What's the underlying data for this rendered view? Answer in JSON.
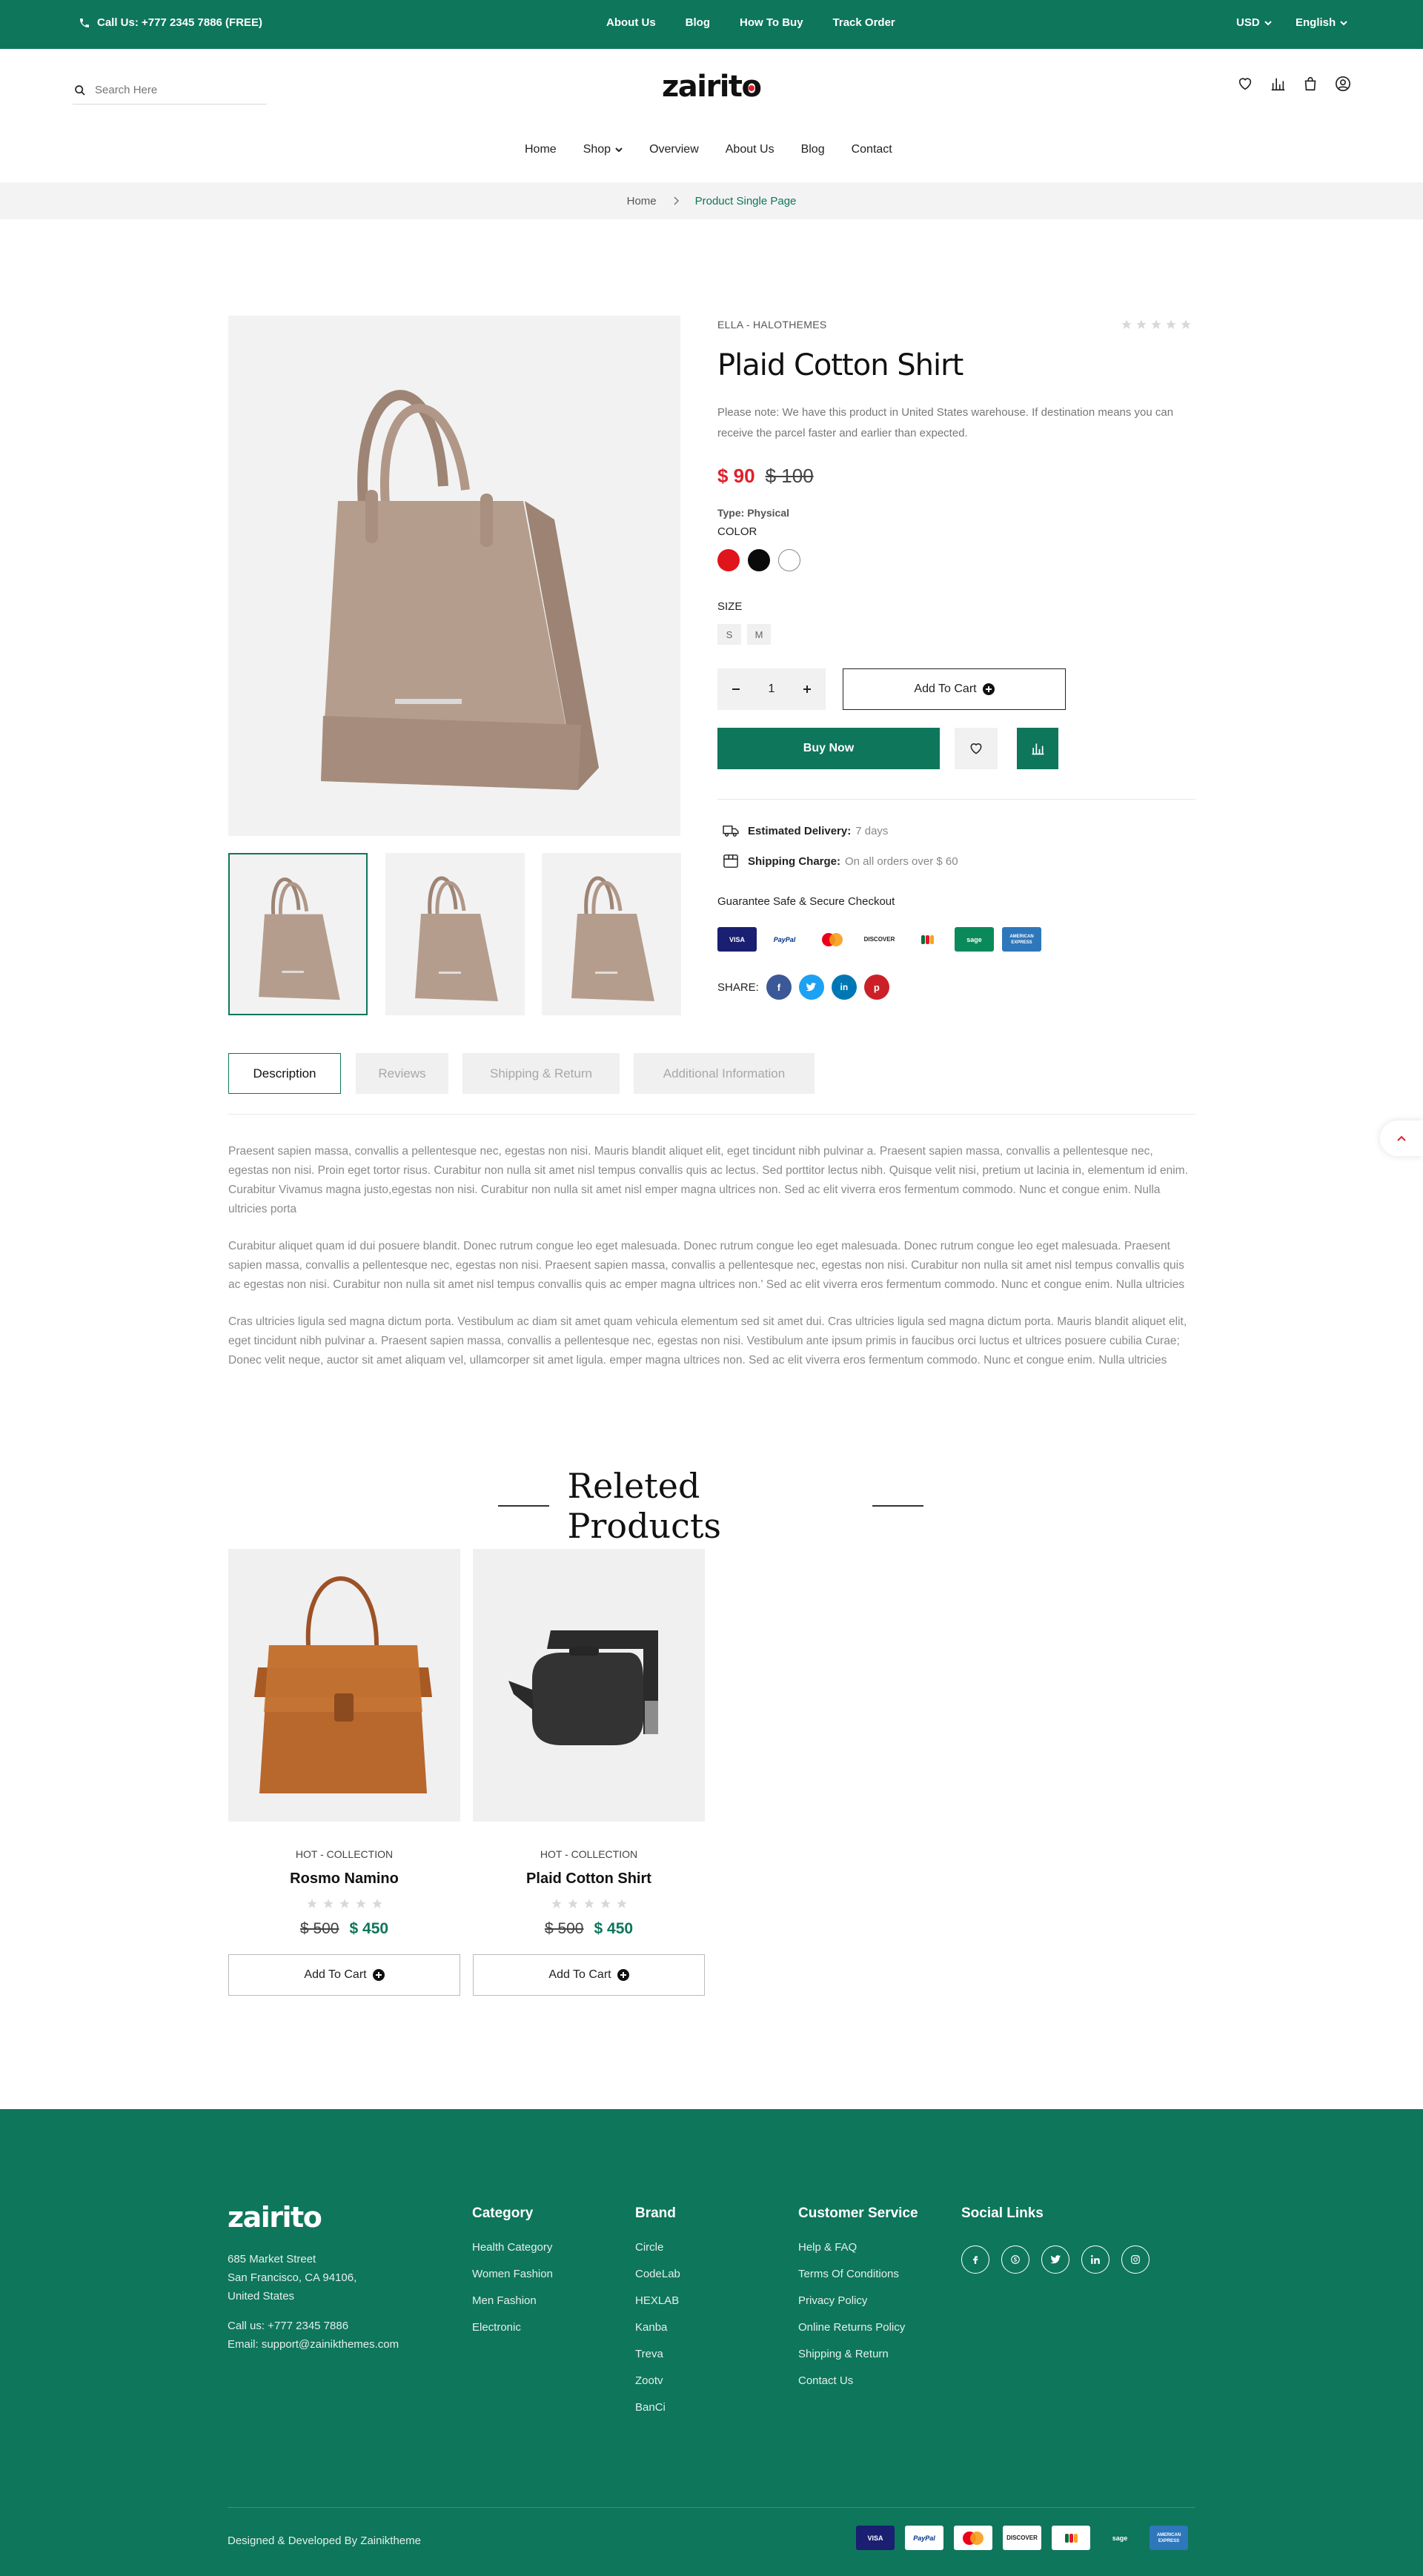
{
  "topbar": {
    "call": "Call Us: +777 2345 7886 (FREE)",
    "links": [
      "About Us",
      "Blog",
      "How To Buy",
      "Track Order"
    ],
    "currency": "USD",
    "language": "English"
  },
  "header": {
    "search_placeholder": "Search Here",
    "logo_text": "zairito",
    "nav": [
      "Home",
      "Shop",
      "Overview",
      "About Us",
      "Blog",
      "Contact"
    ]
  },
  "breadcrumb": {
    "home": "Home",
    "current": "Product Single Page"
  },
  "product": {
    "vendor": "ELLA - HALOTHEMES",
    "rating": 0,
    "name": "Plaid Cotton Shirt",
    "note": "Please note: We have this product in United States warehouse. If destination means you can receive the parcel faster and earlier than expected.",
    "price": "$ 90",
    "old_price": "$ 100",
    "type_label": "Type: Physical",
    "color_label": "COLOR",
    "colors": [
      "#e0141b",
      "#0a0a0a",
      "#ffffff"
    ],
    "size_label": "SIZE",
    "sizes": [
      "S",
      "M"
    ],
    "quantity": "1",
    "add_to_cart": "Add To Cart",
    "buy_now": "Buy Now",
    "delivery_label": "Estimated Delivery:",
    "delivery_value": "7 days",
    "shipping_label": "Shipping Charge:",
    "shipping_value": "On all orders over $ 60",
    "guarantee": "Guarantee Safe & Secure Checkout",
    "payments": [
      "VISA",
      "PayPal",
      "mastercard",
      "DISCOVER",
      "jcb",
      "sage",
      "AMERICAN EXPRESS"
    ],
    "share_label": "SHARE:"
  },
  "tabs": [
    "Description",
    "Reviews",
    "Shipping & Return",
    "Additional Information"
  ],
  "description": [
    "Praesent sapien massa, convallis a pellentesque nec, egestas non nisi. Mauris blandit aliquet elit, eget tincidunt nibh pulvinar a. Praesent sapien massa, convallis a pellentesque nec, egestas non nisi. Proin eget tortor risus. Curabitur non nulla sit amet nisl tempus convallis quis ac lectus. Sed porttitor lectus nibh. Quisque velit nisi, pretium ut lacinia in, elementum id enim. Curabitur Vivamus magna justo,egestas non nisi. Curabitur non nulla sit amet nisl emper magna ultrices non. Sed ac elit viverra eros fermentum commodo. Nunc et congue enim. Nulla ultricies porta",
    "Curabitur aliquet quam id dui posuere blandit. Donec rutrum congue leo eget malesuada. Donec rutrum congue leo eget malesuada. Donec rutrum congue leo eget malesuada. Praesent sapien massa, convallis a pellentesque nec, egestas non nisi. Praesent sapien massa, convallis a pellentesque nec, egestas non nisi. Curabitur non nulla sit amet nisl tempus convallis quis ac egestas non nisi. Curabitur non nulla sit amet nisl tempus convallis quis ac emper magna ultrices non.' Sed ac elit viverra eros fermentum commodo. Nunc et congue enim. Nulla ultricies",
    "Cras ultricies ligula sed magna dictum porta. Vestibulum ac diam sit amet quam vehicula elementum sed sit amet dui. Cras ultricies ligula sed magna dictum porta. Mauris blandit aliquet elit, eget tincidunt nibh pulvinar a. Praesent sapien massa, convallis a pellentesque nec, egestas non nisi. Vestibulum ante ipsum primis in faucibus orci luctus et ultrices posuere cubilia Curae; Donec velit neque, auctor sit amet aliquam vel, ullamcorper sit amet ligula. emper magna ultrices non. Sed ac elit viverra eros fermentum commodo. Nunc et congue enim. Nulla ultricies"
  ],
  "related": {
    "title": "Releted Products",
    "items": [
      {
        "collection": "HOT - COLLECTION",
        "name": "Rosmo Namino",
        "old_price": "$ 500",
        "price": "$ 450",
        "button": "Add To Cart"
      },
      {
        "collection": "HOT - COLLECTION",
        "name": "Plaid Cotton Shirt",
        "old_price": "$ 500",
        "price": "$ 450",
        "button": "Add To Cart"
      }
    ]
  },
  "footer": {
    "logo_text": "zairito",
    "address": [
      "685 Market Street",
      "San Francisco, CA 94106,",
      "United States"
    ],
    "phone": "Call us: +777 2345 7886",
    "email": "Email: support@zainikthemes.com",
    "category": {
      "title": "Category",
      "items": [
        "Health Category",
        "Women Fashion",
        "Men Fashion",
        "Electronic"
      ]
    },
    "brand": {
      "title": "Brand",
      "items": [
        "Circle",
        "CodeLab",
        "HEXLAB",
        "Kanba",
        "Treva",
        "Zootv",
        "BanCi"
      ]
    },
    "service": {
      "title": "Customer Service",
      "items": [
        "Help & FAQ",
        "Terms Of Conditions",
        "Privacy Policy",
        "Online Returns Policy",
        "Shipping & Return",
        "Contact Us"
      ]
    },
    "social_title": "Social Links",
    "copyright": "Designed & Developed By Zainiktheme",
    "payments": [
      "VISA",
      "PayPal",
      "mastercard",
      "DISCOVER",
      "jcb",
      "sage",
      "AMERICAN EXPRESS"
    ]
  },
  "colors": {
    "brand": "#0e765b",
    "sale": "#e0202b"
  }
}
